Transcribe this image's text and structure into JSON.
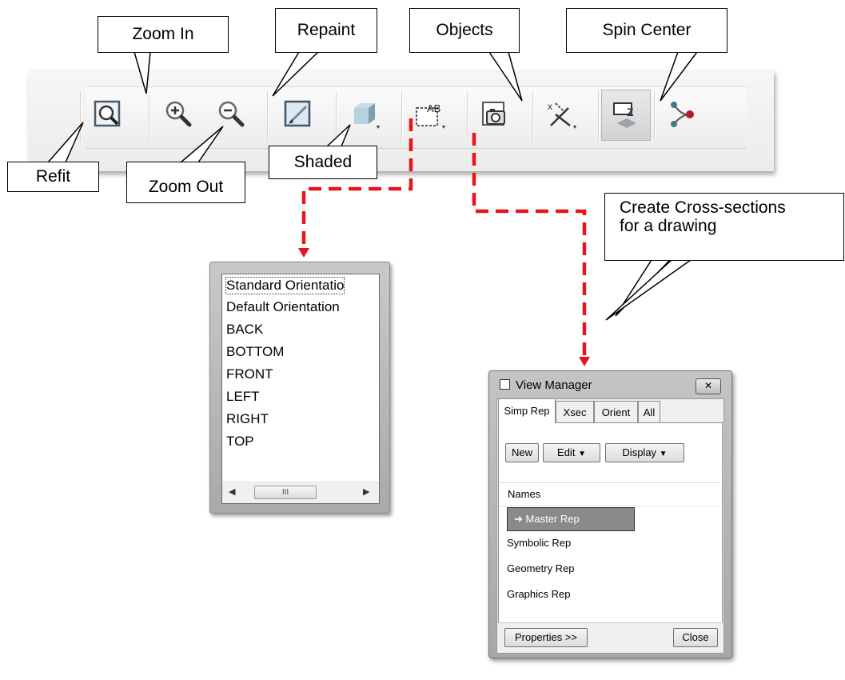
{
  "callouts": {
    "zoom_in": "Zoom In",
    "repaint": "Repaint",
    "objects": "Objects",
    "spin_center": "Spin Center",
    "refit": "Refit",
    "zoom_out": "Zoom Out",
    "shaded": "Shaded",
    "cross_sections_line1": "Create Cross-sections",
    "cross_sections_line2": "for a drawing"
  },
  "toolbar": {
    "buttons": [
      {
        "name": "refit-button",
        "icon": "refit-icon"
      },
      {
        "name": "zoom-in-button",
        "icon": "zoom-in-icon"
      },
      {
        "name": "zoom-out-button",
        "icon": "zoom-out-icon"
      },
      {
        "name": "repaint-button",
        "icon": "repaint-icon"
      },
      {
        "name": "shaded-button",
        "icon": "shaded-cube-icon"
      },
      {
        "name": "saved-orientations-button",
        "icon": "saved-view-icon"
      },
      {
        "name": "view-manager-button",
        "icon": "camera-icon"
      },
      {
        "name": "datum-display-button",
        "icon": "datum-icon"
      },
      {
        "name": "annotation-display-button",
        "icon": "annotation-icon"
      },
      {
        "name": "spin-center-button",
        "icon": "spin-center-icon"
      }
    ],
    "orient_label": "AB"
  },
  "orientation_list": {
    "items": [
      "Standard Orientatio",
      "Default Orientation",
      "BACK",
      "BOTTOM",
      "FRONT",
      "LEFT",
      "RIGHT",
      "TOP"
    ],
    "selected_index": 0,
    "scroll_grip": "III"
  },
  "view_manager": {
    "title": "View Manager",
    "close_glyph": "✕",
    "tabs": [
      "Simp Rep",
      "Xsec",
      "Orient",
      "All"
    ],
    "active_tab": "Simp Rep",
    "buttons": {
      "new": "New",
      "edit": "Edit",
      "display": "Display"
    },
    "dropdown_glyph": "▼",
    "column_header": "Names",
    "rows": [
      "Master Rep",
      "Symbolic Rep",
      "Geometry Rep",
      "Graphics Rep"
    ],
    "selected_row": "Master Rep",
    "properties_label": "Properties >>",
    "close_label": "Close"
  },
  "colors": {
    "arrow_red": "#e8141b",
    "spin_red": "#b01a33",
    "spin_teal": "#3b7f86"
  }
}
